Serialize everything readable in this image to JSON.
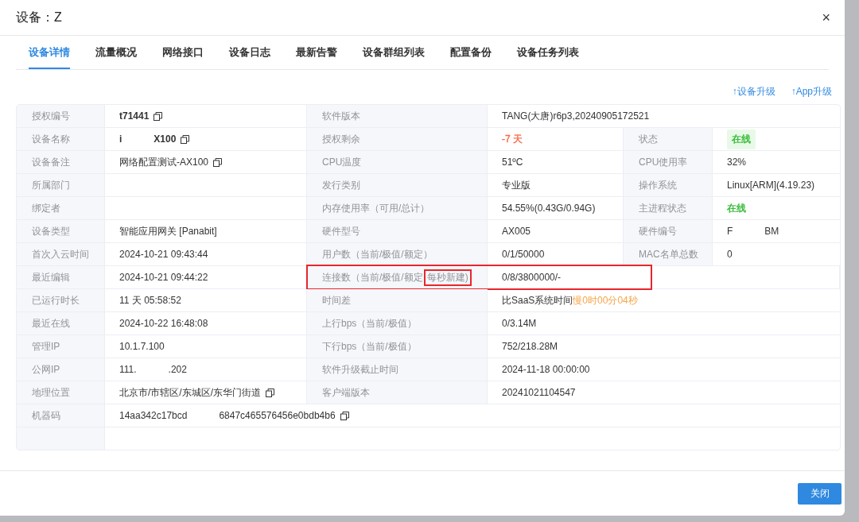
{
  "dialog": {
    "title": "设备：Z",
    "close": "×"
  },
  "tabs": [
    {
      "label": "设备详情",
      "selected": true
    },
    {
      "label": "流量概况",
      "selected": false
    },
    {
      "label": "网络接口",
      "selected": false
    },
    {
      "label": "设备日志",
      "selected": false
    },
    {
      "label": "最新告警",
      "selected": false
    },
    {
      "label": "设备群组列表",
      "selected": false
    },
    {
      "label": "配置备份",
      "selected": false
    },
    {
      "label": "设备任务列表",
      "selected": false
    }
  ],
  "actions": [
    {
      "arrow": "↑",
      "label": "设备升级"
    },
    {
      "arrow": "↑",
      "label": "App升级"
    }
  ],
  "rows": [
    {
      "highlighted": false,
      "cells": [
        {
          "kind": "label",
          "text": "授权编号"
        },
        {
          "kind": "value",
          "parts": [
            "t71441"
          ],
          "bold": true,
          "copy": true
        },
        {
          "kind": "label",
          "text": "软件版本"
        },
        {
          "kind": "value",
          "parts": [
            "TANG(大唐)r6p3,20240905172521"
          ]
        }
      ]
    },
    {
      "highlighted": false,
      "cells": [
        {
          "kind": "label",
          "text": "设备名称"
        },
        {
          "kind": "value",
          "parts": [
            "i",
            "X100"
          ],
          "bold": true,
          "copy": true
        },
        {
          "kind": "label",
          "text": "授权剩余"
        },
        {
          "kind": "value",
          "parts": [
            "-7 天"
          ],
          "color": "#f56c48"
        },
        {
          "kind": "label",
          "text": "状态"
        },
        {
          "kind": "value",
          "parts": [
            "在线"
          ],
          "color": "#2eb82e",
          "badge": true
        }
      ]
    },
    {
      "highlighted": false,
      "cells": [
        {
          "kind": "label",
          "text": "设备备注"
        },
        {
          "kind": "value",
          "parts": [
            "网络配置测试-AX100"
          ],
          "copy": true
        },
        {
          "kind": "label",
          "text": "CPU温度"
        },
        {
          "kind": "value",
          "parts": [
            "51ºC"
          ]
        },
        {
          "kind": "label",
          "text": "CPU使用率"
        },
        {
          "kind": "value",
          "parts": [
            "32%"
          ]
        }
      ]
    },
    {
      "highlighted": false,
      "cells": [
        {
          "kind": "label",
          "text": "所属部门"
        },
        {
          "kind": "value"
        },
        {
          "kind": "label",
          "text": "发行类别"
        },
        {
          "kind": "value",
          "parts": [
            "专业版"
          ]
        },
        {
          "kind": "label",
          "text": "操作系统"
        },
        {
          "kind": "value",
          "parts": [
            "Linux[ARM](4.19.23)"
          ]
        }
      ]
    },
    {
      "highlighted": false,
      "cells": [
        {
          "kind": "label",
          "text": "绑定者"
        },
        {
          "kind": "value"
        },
        {
          "kind": "label",
          "text": "内存使用率（可用/总计）"
        },
        {
          "kind": "value",
          "parts": [
            "54.55%(0.43G/0.94G)"
          ]
        },
        {
          "kind": "label",
          "text": "主进程状态"
        },
        {
          "kind": "value",
          "parts": [
            "在线"
          ],
          "color": "#2eb82e"
        }
      ]
    },
    {
      "highlighted": false,
      "cells": [
        {
          "kind": "label",
          "text": "设备类型"
        },
        {
          "kind": "value",
          "parts": [
            "智能应用网关 [Panabit]"
          ]
        },
        {
          "kind": "label",
          "text": "硬件型号"
        },
        {
          "kind": "value",
          "parts": [
            "AX005"
          ]
        },
        {
          "kind": "label",
          "text": "硬件编号"
        },
        {
          "kind": "value",
          "parts": [
            "F",
            "BM"
          ]
        }
      ]
    },
    {
      "highlighted": false,
      "cells": [
        {
          "kind": "label",
          "text": "首次入云时间"
        },
        {
          "kind": "value",
          "parts": [
            "2024-10-21 09:43:44"
          ]
        },
        {
          "kind": "label",
          "text": "用户数（当前/极值/额定）"
        },
        {
          "kind": "value",
          "parts": [
            "0/1/50000"
          ]
        },
        {
          "kind": "label",
          "text": "MAC名单总数"
        },
        {
          "kind": "value",
          "parts": [
            "0"
          ]
        }
      ]
    },
    {
      "highlighted": true,
      "cells": [
        {
          "kind": "label",
          "text": "最近编辑"
        },
        {
          "kind": "value",
          "parts": [
            "2024-10-21 09:44:22"
          ]
        },
        {
          "kind": "label",
          "text": "连接数（当前/极值/额定",
          "marked": "每秒新建)"
        },
        {
          "kind": "value",
          "parts": [
            "0/8/3800000/-"
          ]
        }
      ]
    },
    {
      "highlighted": false,
      "cells": [
        {
          "kind": "label",
          "text": "已运行时长"
        },
        {
          "kind": "value",
          "parts": [
            "11 天 05:58:52"
          ]
        },
        {
          "kind": "label",
          "text": "时间差"
        },
        {
          "kind": "value",
          "parts": [
            "比SaaS系统时间"
          ],
          "suffix": {
            "text": "慢0时00分04秒",
            "color": "#f6a54a"
          }
        }
      ]
    },
    {
      "highlighted": false,
      "cells": [
        {
          "kind": "label",
          "text": "最近在线"
        },
        {
          "kind": "value",
          "parts": [
            "2024-10-22 16:48:08"
          ]
        },
        {
          "kind": "label",
          "text": "上行bps（当前/极值）"
        },
        {
          "kind": "value",
          "parts": [
            "0/3.14M"
          ]
        }
      ]
    },
    {
      "highlighted": false,
      "cells": [
        {
          "kind": "label",
          "text": "管理IP"
        },
        {
          "kind": "value",
          "parts": [
            "10.1.7.100"
          ]
        },
        {
          "kind": "label",
          "text": "下行bps（当前/极值）"
        },
        {
          "kind": "value",
          "parts": [
            "752/218.28M"
          ]
        }
      ]
    },
    {
      "highlighted": false,
      "cells": [
        {
          "kind": "label",
          "text": "公网IP"
        },
        {
          "kind": "value",
          "parts": [
            "111.",
            ".202"
          ]
        },
        {
          "kind": "label",
          "text": "软件升级截止时间"
        },
        {
          "kind": "value",
          "parts": [
            "2024-11-18 00:00:00"
          ]
        }
      ]
    },
    {
      "highlighted": false,
      "cells": [
        {
          "kind": "label",
          "text": "地理位置"
        },
        {
          "kind": "value",
          "parts": [
            "北京市/市辖区/东城区/东华门街道"
          ],
          "copy": true
        },
        {
          "kind": "label",
          "text": "客户端版本"
        },
        {
          "kind": "value",
          "parts": [
            "20241021104547"
          ]
        }
      ]
    },
    {
      "highlighted": false,
      "cells": [
        {
          "kind": "label",
          "text": "机器码"
        },
        {
          "kind": "value",
          "parts": [
            "14aa342c17bcd",
            "6847c465576456e0bdb4b6"
          ],
          "copy": true
        }
      ]
    },
    {
      "highlighted": false,
      "cells": []
    }
  ],
  "footer": {
    "button": "关闭"
  }
}
